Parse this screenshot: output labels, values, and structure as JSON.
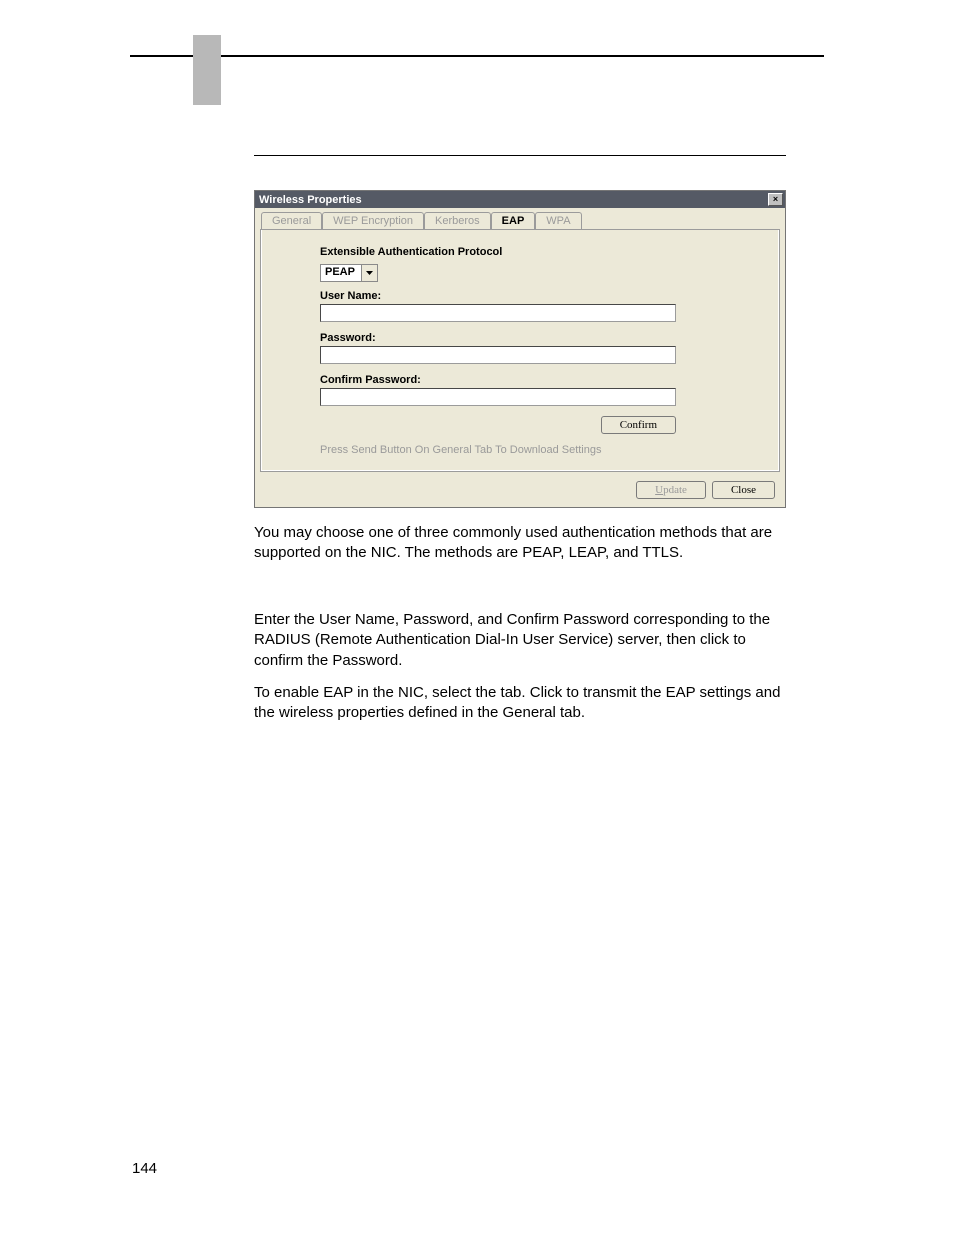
{
  "page_number": "144",
  "dialog": {
    "title": "Wireless Properties",
    "tabs": {
      "general": "General",
      "wep": "WEP Encryption",
      "kerberos": "Kerberos",
      "eap": "EAP",
      "wpa": "WPA"
    },
    "eap_panel": {
      "proto_label": "Extensible Authentication Protocol",
      "proto_value": "PEAP",
      "username_label": "User Name:",
      "password_label": "Password:",
      "confirm_label": "Confirm Password:",
      "confirm_button": "Confirm",
      "status_line": "Press Send Button On General Tab To Download Settings"
    },
    "buttons": {
      "update": "Update",
      "close": "Close"
    }
  },
  "paragraphs": {
    "p1": "You may choose one of three commonly used authentication methods that are supported on the NIC. The methods are PEAP, LEAP, and TTLS.",
    "p2a": "Enter the User Name, Password, and Confirm Password corresponding to the RADIUS (Remote Authentication Dial-In User Service) server, then click ",
    "p2b": " to confirm the Password.",
    "p3a": "To enable EAP in the NIC, select the ",
    "p3b": " tab. Click ",
    "p3c": " to transmit the EAP settings and the wireless properties defined in the General tab."
  }
}
